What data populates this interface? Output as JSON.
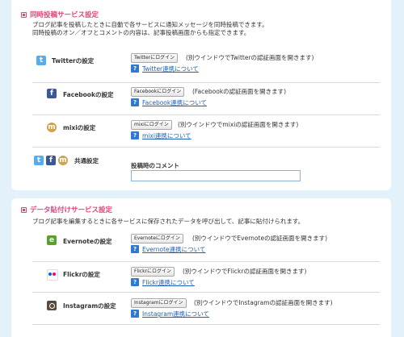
{
  "simul": {
    "title": "同時投稿サービス設定",
    "desc1": "ブログ記事を投稿したときに自動で各サービスに通知メッセージを同時投稿できます。",
    "desc2": "同時投稿のオン／オフとコメントの内容は、記事投稿画面からも指定できます。",
    "twitter": {
      "name": "Twitterの設定",
      "button": "Twitterにログイン",
      "note": "(別ウインドウでTwitterの認証画面を開きます)",
      "link": "Twitter連携について"
    },
    "facebook": {
      "name": "Facebookの設定",
      "button": "Facebookにログイン",
      "note": "(Facebookの認証画面を開きます)",
      "link": "Facebook連携について"
    },
    "mixi": {
      "name": "mixiの設定",
      "button": "mixiにログイン",
      "note": "(別ウインドウでmixiの認証画面を開きます)",
      "link": "mixi連携について"
    },
    "common": {
      "name": "共通設定",
      "comment_label": "投稿時のコメント"
    }
  },
  "paste": {
    "title": "データ貼付けサービス設定",
    "desc": "ブログ記事を編集するときに各サービスに保存されたデータを呼び出して、記事に貼付けられます。",
    "evernote": {
      "name": "Evernoteの設定",
      "button": "Evernoteにログイン",
      "note": "(別ウインドウでEvernoteの認証画面を開きます)",
      "link": "Evernote連携について"
    },
    "flickr": {
      "name": "Flickrの設定",
      "button": "Flickrにログイン",
      "note": "(別ウインドウでFlickrの認証画面を開きます)",
      "link": "Flickr連携について"
    },
    "instagram": {
      "name": "Instagramの設定",
      "button": "Instagramにログイン",
      "note": "(別ウインドウでInstagramの認証画面を開きます)",
      "link": "Instagram連携について"
    }
  },
  "help_glyph": "?",
  "icons": {
    "twitter": "twitter-icon",
    "facebook": "facebook-icon",
    "mixi": "mixi-icon",
    "evernote": "evernote-icon",
    "flickr": "flickr-icon",
    "instagram": "instagram-icon"
  }
}
